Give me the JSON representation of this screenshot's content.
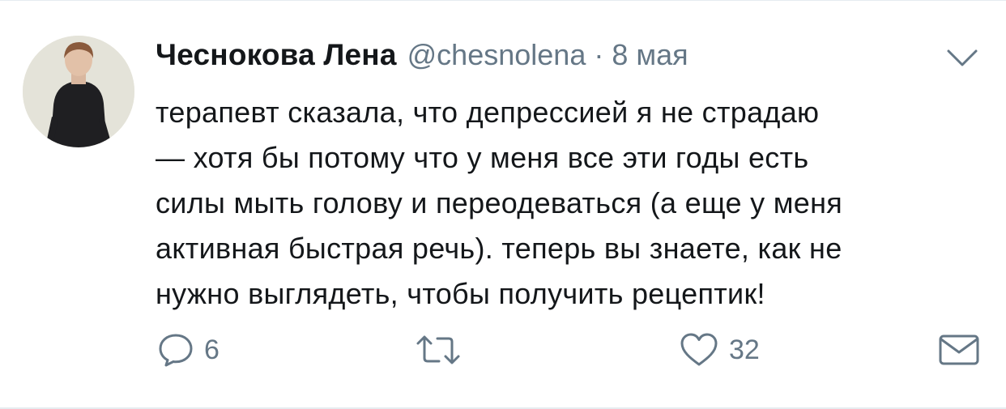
{
  "tweet": {
    "author": {
      "display_name": "Чеснокова Лена",
      "handle": "@chesnolena"
    },
    "separator": "·",
    "date": "8 мая",
    "text_lines": [
      "терапевт сказала, что депрессией я не страдаю",
      "— хотя бы потому что у меня все эти годы есть",
      "силы мыть голову и переодеваться (а еще у меня",
      "активная быстрая речь). теперь вы знаете, как не",
      "нужно выглядеть, чтобы получить рецептик!"
    ],
    "actions": {
      "reply_count": "6",
      "like_count": "32"
    }
  },
  "icons": {
    "menu": "chevron-down-icon",
    "reply": "speech-bubble-icon",
    "retweet": "retweet-icon",
    "like": "heart-icon",
    "message": "envelope-icon"
  },
  "colors": {
    "text": "#14171a",
    "secondary": "#657786",
    "divider": "#e6ecf0"
  }
}
